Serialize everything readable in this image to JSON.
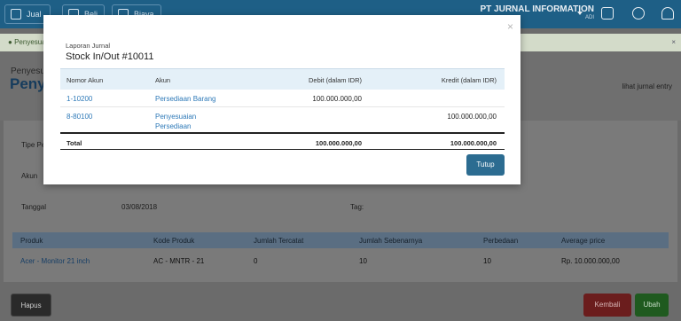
{
  "topbar": {
    "buttons": [
      "Jual",
      "Beli",
      "Biaya"
    ],
    "company": "PT JURNAL INFORMATION",
    "user": "ADI"
  },
  "alert": {
    "text": "Penyesuai"
  },
  "page": {
    "breadcrumb": "Penyesu",
    "title": "Penye",
    "lihat_link": "lihat jurnal entry"
  },
  "form": {
    "tipe_label": "Tipe Pe",
    "akun_label": "Akun",
    "tanggal_label": "Tanggal",
    "tanggal_value": "03/08/2018",
    "tag_label": "Tag:"
  },
  "detail_table": {
    "headers": [
      "Produk",
      "Kode Produk",
      "Jumlah Tercatat",
      "Jumlah Sebenarnya",
      "Perbedaan",
      "Average price"
    ],
    "rows": [
      [
        "Acer - Monitor 21 inch",
        "AC - MNTR - 21",
        "0",
        "10",
        "10",
        "Rp. 10.000.000,00"
      ]
    ]
  },
  "actions": {
    "hapus": "Hapus",
    "kembali": "Kembali",
    "ubah": "Ubah"
  },
  "modal": {
    "close": "×",
    "subtitle": "Laporan Jurnal",
    "title": "Stock In/Out #10011",
    "headers": [
      "Nomor Akun",
      "Akun",
      "Debit (dalam IDR)",
      "Kredit (dalam IDR)"
    ],
    "rows": [
      {
        "nomor": "1-10200",
        "akun": "Persediaan Barang",
        "debit": "100.000.000,00",
        "kredit": ""
      },
      {
        "nomor": "8-80100",
        "akun_1": "Penyesuaian",
        "akun_2": "Persediaan",
        "debit": "",
        "kredit": "100.000.000,00"
      }
    ],
    "total": {
      "label": "Total",
      "debit": "100.000.000,00",
      "kredit": "100.000.000,00"
    },
    "tutup": "Tutup"
  }
}
